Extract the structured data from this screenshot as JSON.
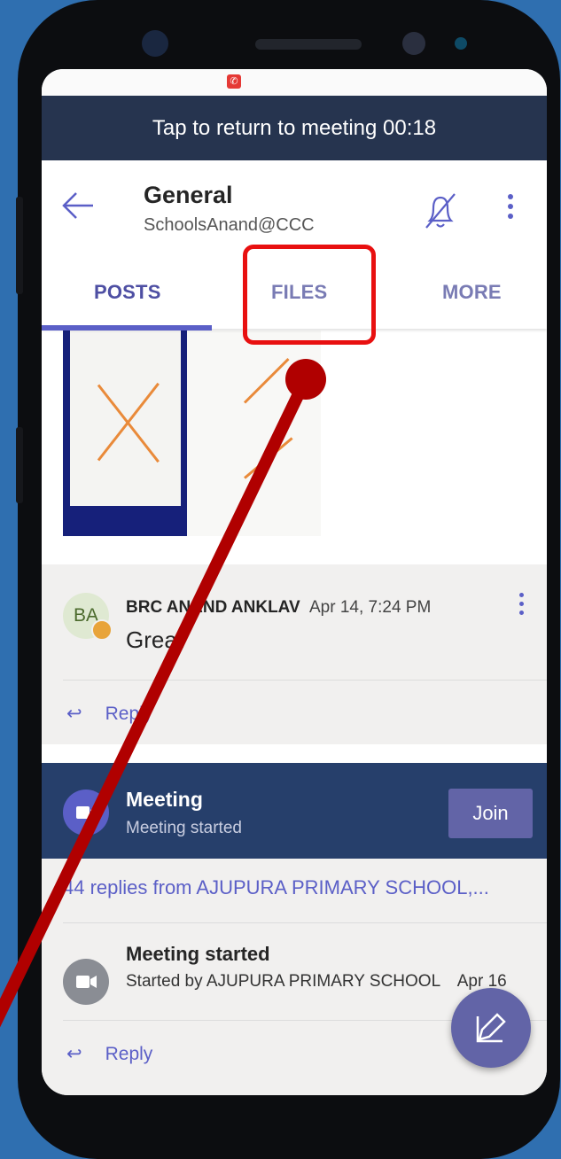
{
  "meeting_banner": {
    "text": "Tap to return to meeting 00:18"
  },
  "header": {
    "title": "General",
    "subtitle": "SchoolsAnand@CCC",
    "back_icon": "back-arrow-icon",
    "bell_icon": "bell-off-icon",
    "more_icon": "more-vertical-icon"
  },
  "tabs": [
    {
      "label": "POSTS",
      "selected": true
    },
    {
      "label": "FILES",
      "selected": false
    },
    {
      "label": "MORE",
      "selected": false
    }
  ],
  "post": {
    "avatar_initials": "BA",
    "author": "BRC ANAND ANKLAV",
    "time": "Apr 14, 7:24 PM",
    "text": "Great",
    "reply_label": "Reply"
  },
  "meeting": {
    "title": "Meeting",
    "status": "Meeting started",
    "join_label": "Join"
  },
  "thread": {
    "replies_link": "44 replies from AJUPURA PRIMARY SCHOOL,...",
    "event_title": "Meeting started",
    "event_sub": "Started by AJUPURA PRIMARY SCHOOL",
    "event_date": "Apr 16",
    "reply_label": "Reply"
  },
  "colors": {
    "accent": "#5b5fc7",
    "banner": "#26344f",
    "meeting_card": "#263f6b",
    "annotation": "#e81010",
    "pointer": "#b00000"
  }
}
